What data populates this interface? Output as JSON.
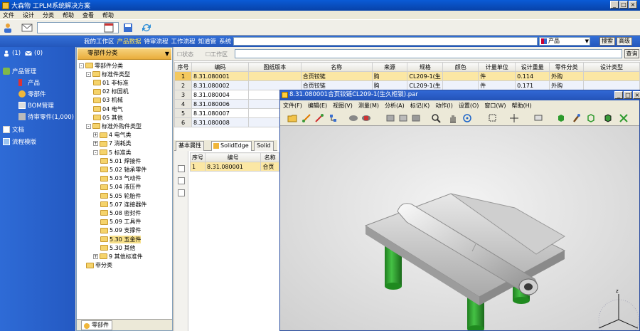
{
  "window": {
    "title": "大森物 工PLM系统解决方案"
  },
  "menubar": [
    "文件",
    "设计",
    "分类",
    "帮助",
    "查看",
    "帮助"
  ],
  "bluestrip": {
    "links": [
      "我的工作区",
      "产品数据",
      "待审流程",
      "工作流程",
      "知道管",
      "系统"
    ],
    "active_index": 1,
    "type_value": "产品",
    "search_btn": "搜索",
    "advanced_btn": "高级"
  },
  "leftnav": {
    "top_counts": [
      "(1)",
      "(0)"
    ],
    "items": [
      {
        "label": "产品管理",
        "icon": "product-icon"
      },
      {
        "label": "产品",
        "icon": "grid-icon"
      },
      {
        "label": "零部件",
        "icon": "gear-icon"
      },
      {
        "label": "BOM管理",
        "icon": "bom-icon"
      },
      {
        "label": "待审零件(1,000)",
        "icon": "pending-icon"
      },
      {
        "label": "文档",
        "icon": "document-icon"
      },
      {
        "label": "流程模版",
        "icon": "workflow-icon"
      }
    ]
  },
  "tree": {
    "header": "零部件分类",
    "nodes": [
      {
        "label": "零部件分类",
        "level": 0,
        "exp": "-"
      },
      {
        "label": "标准件类型",
        "level": 1,
        "exp": "-"
      },
      {
        "label": "01 非标准",
        "level": 2
      },
      {
        "label": "02 标国机",
        "level": 2
      },
      {
        "label": "03 机械",
        "level": 2
      },
      {
        "label": "04 电气",
        "level": 2
      },
      {
        "label": "05 其他",
        "level": 2
      },
      {
        "label": "标准外购件类型",
        "level": 1,
        "exp": "-"
      },
      {
        "label": "4 电气类",
        "level": 2,
        "exp": "+"
      },
      {
        "label": "7 消耗类",
        "level": 2,
        "exp": "+"
      },
      {
        "label": "5 标准类",
        "level": 2,
        "exp": "-"
      },
      {
        "label": "5.01 焊接件",
        "level": 3
      },
      {
        "label": "5.02 轴承零件",
        "level": 3
      },
      {
        "label": "5.03 气动件",
        "level": 3
      },
      {
        "label": "5.04 液压件",
        "level": 3
      },
      {
        "label": "5.05 轮胎件",
        "level": 3
      },
      {
        "label": "5.07 连接器件",
        "level": 3
      },
      {
        "label": "5.08 密封件",
        "level": 3
      },
      {
        "label": "5.09 工具件",
        "level": 3
      },
      {
        "label": "5.09 支撑件",
        "level": 3
      },
      {
        "label": "5.30 五金件",
        "level": 3,
        "selected": true
      },
      {
        "label": "5.30 其他",
        "level": 3
      },
      {
        "label": "9 其他标准件",
        "level": 2,
        "exp": "+"
      },
      {
        "label": "非分类",
        "level": 1
      }
    ],
    "bottom_tab": "零部件"
  },
  "main": {
    "checkbox1": "☐状态",
    "checkbox2": "☐工作区",
    "filter_btn": "查询",
    "columns": [
      "序号",
      "编码",
      "图纸版本",
      "名称",
      "来源",
      "规格",
      "颜色",
      "计量单位",
      "设计重量",
      "零件分类",
      "设计类型"
    ],
    "rows": [
      [
        "1",
        "8.31.080001",
        "",
        "合页铰链",
        "购",
        "CL209-1(生",
        "",
        "件",
        "0.114",
        "外购",
        ""
      ],
      [
        "2",
        "8.31.080002",
        "",
        "合页铰链",
        "购",
        "CL209-1(生",
        "",
        "件",
        "0.171",
        "外购",
        ""
      ],
      [
        "3",
        "8.31.080004",
        "",
        "",
        "",
        "",
        "",
        "",
        "",
        "",
        ""
      ],
      [
        "4",
        "8.31.080006",
        "",
        "",
        "",
        "",
        "",
        "",
        "",
        "",
        ""
      ],
      [
        "5",
        "8.31.080007",
        "",
        "",
        "",
        "",
        "",
        "",
        "",
        "",
        ""
      ],
      [
        "6",
        "8.31.080008",
        "",
        "",
        "",
        "",
        "",
        "",
        "",
        "",
        ""
      ]
    ],
    "detail_tabs": [
      "基本属性",
      "SolidEdge",
      "Solid"
    ],
    "detail_columns": [
      "序号",
      "编号",
      "名称"
    ],
    "detail_rows": [
      [
        "1",
        "8.31.080001",
        "合页"
      ]
    ]
  },
  "viewer": {
    "title": "8.31.080001合页铰链CL209-1(生久柜锁).par",
    "menu": [
      "文件(F)",
      "编辑(E)",
      "视图(V)",
      "测量(M)",
      "分析(A)",
      "标记(K)",
      "动作(I)",
      "设置(O)",
      "窗口(W)",
      "帮助(H)"
    ]
  },
  "colors": {
    "accent_blue": "#2e6bd6",
    "highlight": "#fbe7a4",
    "part_gray": "#b8b8b8",
    "leg_green": "#2f9e2f"
  }
}
